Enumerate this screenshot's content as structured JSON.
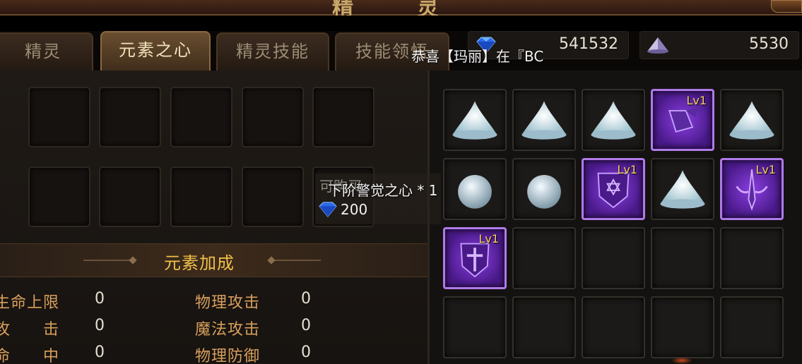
{
  "header": {
    "title": "精 灵"
  },
  "tabs": [
    {
      "label": "精灵",
      "active": false
    },
    {
      "label": "元素之心",
      "active": true
    },
    {
      "label": "精灵技能",
      "active": false
    },
    {
      "label": "技能领悟",
      "active": false
    }
  ],
  "currency": {
    "gems": {
      "value": "541532",
      "icon": "blue-diamond-icon"
    },
    "crystal": {
      "value": "5530",
      "icon": "crystal-cone-icon"
    }
  },
  "broadcast": "恭喜【玛丽】在『BC",
  "tooltip": {
    "underlay": "可购买",
    "item": "下阶警觉之心 * 1",
    "price": "200"
  },
  "bonus": {
    "title": "元素加成",
    "stats": [
      {
        "label": "生命上限",
        "value": "0"
      },
      {
        "label": "攻　　击",
        "value": "0"
      },
      {
        "label": "命　　中",
        "value": "0"
      },
      {
        "label": "物理攻击",
        "value": "0"
      },
      {
        "label": "魔法攻击",
        "value": "0"
      },
      {
        "label": "物理防御",
        "value": "0"
      }
    ]
  },
  "inventory": {
    "items": [
      {
        "kind": "crystal-pile",
        "level": ""
      },
      {
        "kind": "crystal-pile",
        "level": ""
      },
      {
        "kind": "crystal-pile",
        "level": ""
      },
      {
        "kind": "wing-boot-heart",
        "level": "Lv1"
      },
      {
        "kind": "crystal-pile",
        "level": ""
      },
      {
        "kind": "pearl-orb",
        "level": ""
      },
      {
        "kind": "pearl-orb",
        "level": ""
      },
      {
        "kind": "star-shield-heart",
        "level": "Lv1"
      },
      {
        "kind": "crystal-pile",
        "level": ""
      },
      {
        "kind": "flame-sword-heart",
        "level": "Lv1"
      },
      {
        "kind": "cross-shield-heart",
        "level": "Lv1"
      }
    ]
  },
  "colors": {
    "accent_gold": "#f0c04a",
    "stat_label": "#d8a05c",
    "rare_purple": "#8a3ee0"
  }
}
